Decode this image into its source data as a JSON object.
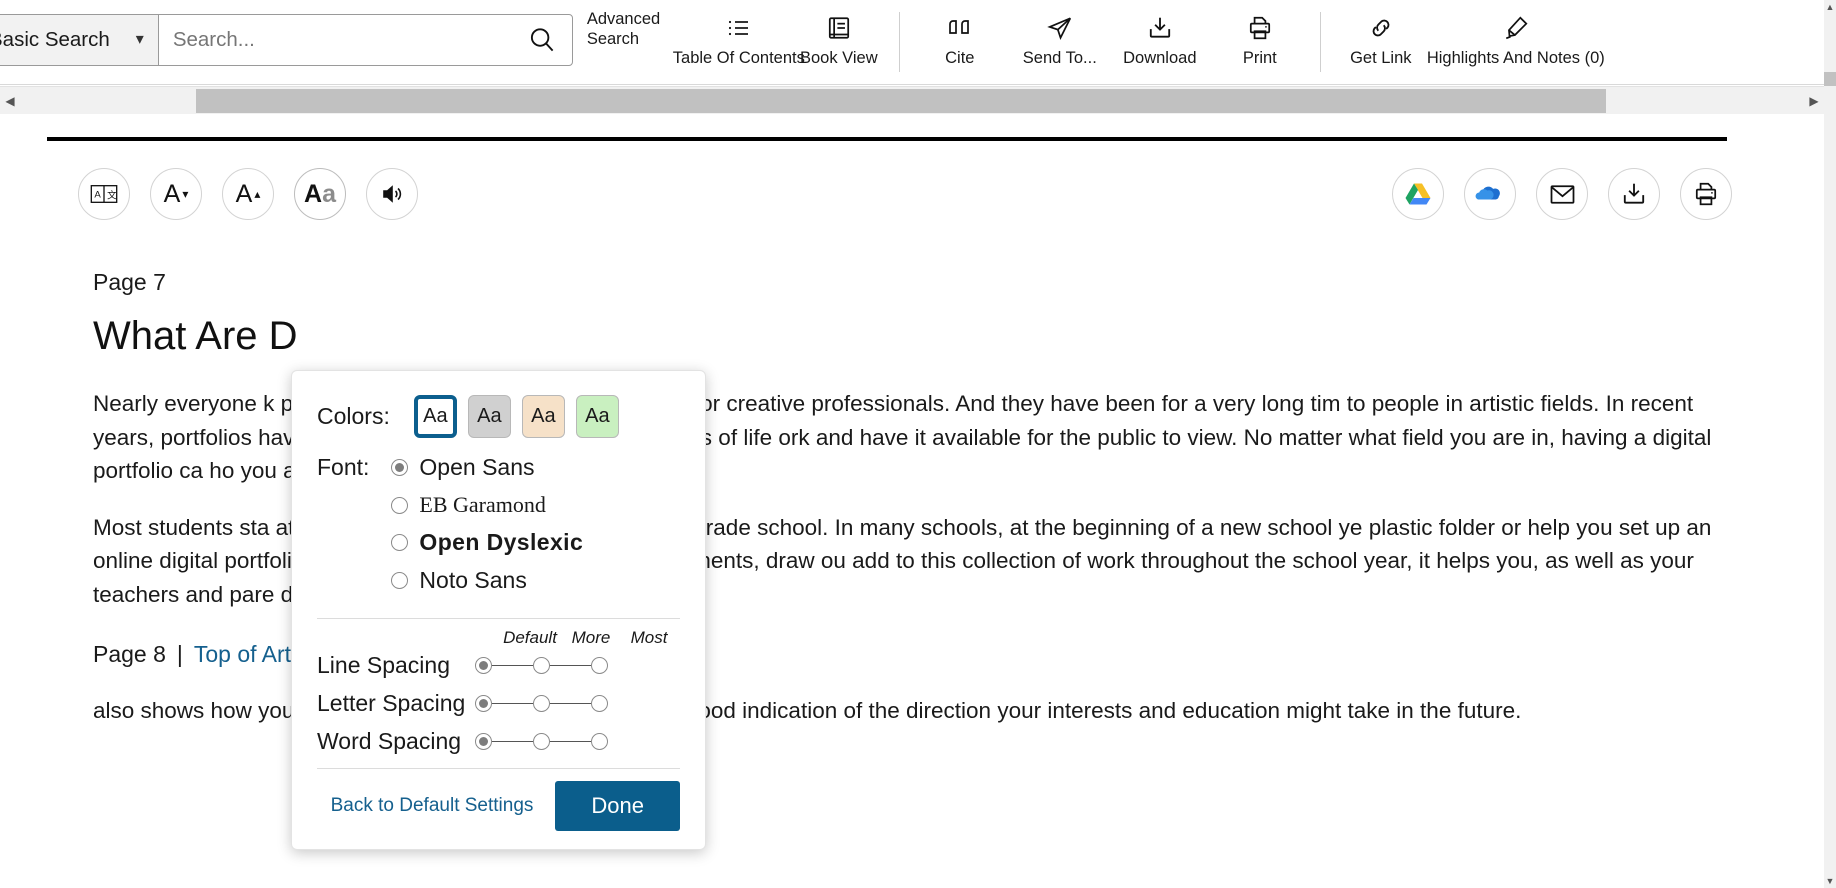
{
  "header": {
    "search_mode": "Basic Search",
    "search_placeholder": "Search...",
    "search_value": "",
    "search_icon": "search-icon",
    "dropdown_icon": "chevron-down-icon",
    "advanced_search": "Advanced Search",
    "tools": [
      {
        "label": "Table Of Contents",
        "icon": "list-icon"
      },
      {
        "label": "Book View",
        "icon": "book-icon"
      },
      {
        "label": "Cite",
        "icon": "quote-icon"
      },
      {
        "label": "Send To...",
        "icon": "paper-plane-icon"
      },
      {
        "label": "Download",
        "icon": "download-icon"
      },
      {
        "label": "Print",
        "icon": "printer-icon"
      },
      {
        "label": "Get Link",
        "icon": "link-icon"
      },
      {
        "label": "Highlights And Notes (0)",
        "icon": "highlighter-icon"
      }
    ]
  },
  "a11y_bar": {
    "left_buttons": [
      {
        "icon": "translate-icon",
        "name": "translate-button"
      },
      {
        "icon": "decrease-font-icon",
        "name": "decrease-font-button"
      },
      {
        "icon": "increase-font-icon",
        "name": "increase-font-button"
      },
      {
        "icon": "display-options-icon",
        "name": "display-options-button"
      },
      {
        "icon": "read-aloud-icon",
        "name": "read-aloud-button"
      }
    ],
    "right_buttons": [
      {
        "icon": "google-drive-icon",
        "name": "save-to-google-drive-button"
      },
      {
        "icon": "onedrive-icon",
        "name": "save-to-onedrive-button"
      },
      {
        "icon": "email-icon",
        "name": "email-button"
      },
      {
        "icon": "download-icon",
        "name": "download-button"
      },
      {
        "icon": "printer-icon",
        "name": "print-button"
      }
    ]
  },
  "article": {
    "page_marker": "Page 7",
    "title": "What Are D",
    "paragraph1": "Nearly everyone k                                      person's best work are a tool of the trade for creative professionals. And they have been for a very long tim                                      to people in artistic fields. In recent years, portfolios have become a way for people in many walks of life                                      ork and have it available for the public to view. No matter what field you are in, having a digital portfolio ca                                      ho you are and what you can do!",
    "paragraph2": "Most students sta                                      at showcases their work when they are in grade school. In many schools, at the beginning of a new school ye                                      plastic folder or help you set up an online digital portfolio, as a place to keep your writing assignments, draw                                      ou add to this collection of work throughout the school year, it helps you, as well as your teachers and pare                                      d accomplished. It",
    "page8_marker": "Page 8",
    "separator": "|",
    "top_of_article": "Top of Article",
    "paragraph3": "also shows how your interests have developed and gives a good indication of the direction your interests and education might take in the future."
  },
  "popup": {
    "colors_label": "Colors:",
    "color_swatches": [
      {
        "label": "Aa",
        "bg": "#ffffff",
        "selected": true,
        "name": "color-white"
      },
      {
        "label": "Aa",
        "bg": "#d0d0d0",
        "selected": false,
        "name": "color-gray"
      },
      {
        "label": "Aa",
        "bg": "#f6e1c8",
        "selected": false,
        "name": "color-tan"
      },
      {
        "label": "Aa",
        "bg": "#c9f0c0",
        "selected": false,
        "name": "color-green"
      }
    ],
    "font_label": "Font:",
    "fonts": [
      {
        "label": "Open Sans",
        "selected": true
      },
      {
        "label": "EB Garamond",
        "selected": false
      },
      {
        "label": "Open Dyslexic",
        "selected": false
      },
      {
        "label": "Noto Sans",
        "selected": false
      }
    ],
    "slider_headers": [
      "Default",
      "More",
      "Most"
    ],
    "sliders": [
      {
        "label": "Line Spacing",
        "value": 0
      },
      {
        "label": "Letter Spacing",
        "value": 0
      },
      {
        "label": "Word Spacing",
        "value": 0
      }
    ],
    "reset_label": "Back to Default Settings",
    "done_label": "Done",
    "accent_color": "#0b5e8c"
  },
  "scrollbars": {
    "h_left_arrow": "◀",
    "h_right_arrow": "▶",
    "v_up_arrow": "▲",
    "v_down_arrow": "▼"
  }
}
